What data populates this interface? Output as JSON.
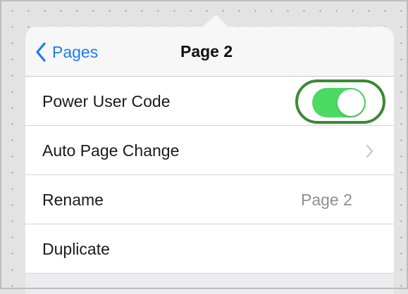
{
  "nav": {
    "back_label": "Pages",
    "title": "Page 2"
  },
  "rows": [
    {
      "label": "Power User Code",
      "control": "toggle",
      "toggle_on": true
    },
    {
      "label": "Auto Page Change",
      "control": "disclosure",
      "icon": "chevron-right-icon"
    },
    {
      "label": "Rename",
      "value": "Page 2"
    },
    {
      "label": "Duplicate"
    }
  ],
  "colors": {
    "accent": "#1a7cf7",
    "toggle_on": "#4cd964",
    "highlight": "#3a8a33"
  }
}
